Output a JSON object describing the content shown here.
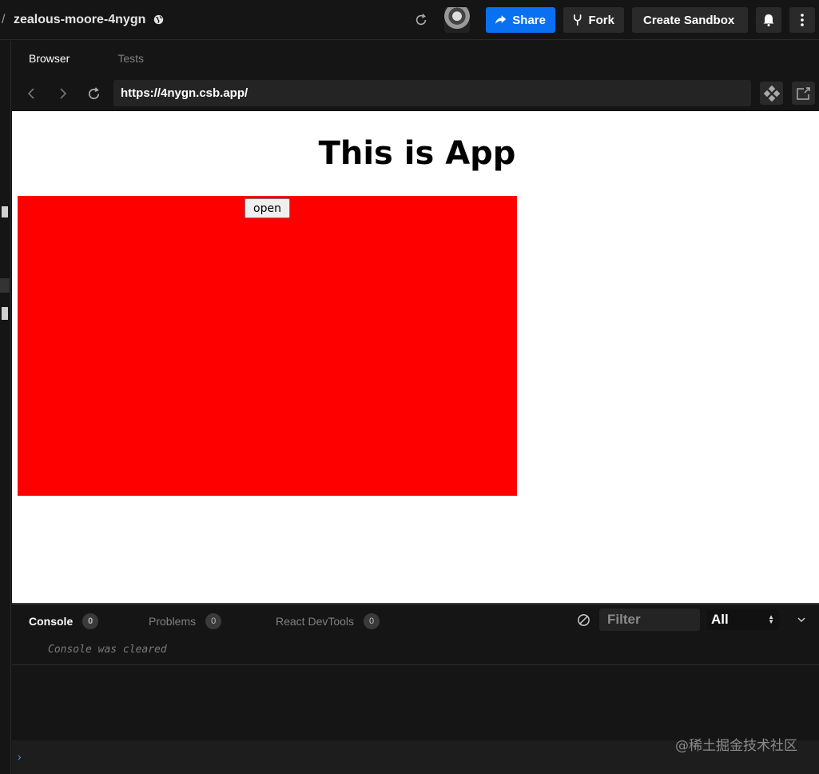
{
  "topbar": {
    "breadcrumb_separator": "/",
    "sandbox_name": "zealous-moore-4nygn",
    "share_label": "Share",
    "fork_label": "Fork",
    "create_label": "Create Sandbox"
  },
  "preview_tabs": [
    {
      "label": "Browser",
      "active": true
    },
    {
      "label": "Tests",
      "active": false
    }
  ],
  "browser": {
    "url": "https://4nygn.csb.app/"
  },
  "app": {
    "title": "This is App",
    "box_color": "#ff0000",
    "open_button_label": "open"
  },
  "console": {
    "tabs": [
      {
        "label": "Console",
        "count": "0",
        "active": true
      },
      {
        "label": "Problems",
        "count": "0",
        "active": false
      },
      {
        "label": "React DevTools",
        "count": "0",
        "active": false
      }
    ],
    "filter_placeholder": "Filter",
    "level": "All",
    "message": "Console was cleared",
    "prompt": "›"
  },
  "watermark": "@稀土掘金技术社区",
  "colors": {
    "accent": "#0971f1",
    "background": "#151515"
  }
}
